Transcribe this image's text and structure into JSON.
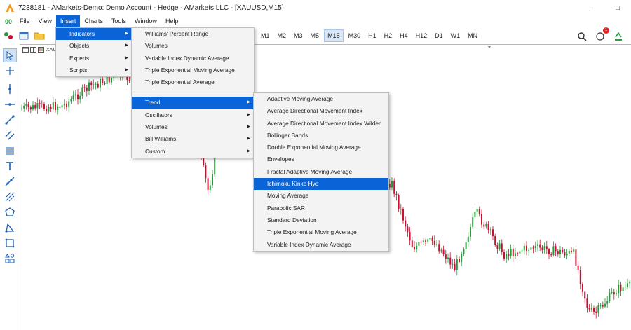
{
  "window": {
    "title": "7238181 - AMarkets-Demo: Demo Account - Hedge - AMarkets LLC - [XAUUSD,M15]",
    "controls": [
      "–",
      "□",
      "✕"
    ]
  },
  "menubar": {
    "items": [
      "File",
      "View",
      "Insert",
      "Charts",
      "Tools",
      "Window",
      "Help"
    ],
    "active": "Insert"
  },
  "toolbar": {
    "timeframes": [
      "M1",
      "M2",
      "M3",
      "M5",
      "M15",
      "M30",
      "H1",
      "H2",
      "H4",
      "H12",
      "D1",
      "W1",
      "MN"
    ],
    "selected_timeframe": "M15",
    "notification_count": "1"
  },
  "chart": {
    "tab_label": "XAUUSD"
  },
  "menus": {
    "insert": [
      "Indicators",
      "Objects",
      "Experts",
      "Scripts"
    ],
    "indicators_top": [
      "Williams' Percent Range",
      "Volumes",
      "Variable Index Dynamic Average",
      "Triple Exponential Moving Average",
      "Triple Exponential Average"
    ],
    "indicators_groups": [
      "Trend",
      "Oscillators",
      "Volumes",
      "Bill Williams",
      "Custom"
    ],
    "trend": [
      "Adaptive Moving Average",
      "Average Directional Movement Index",
      "Average Directional Movement Index Wilder",
      "Bollinger Bands",
      "Double Exponential Moving Average",
      "Envelopes",
      "Fractal Adaptive Moving Average",
      "Ichimoku Kinko Hyo",
      "Moving Average",
      "Parabolic SAR",
      "Standard Deviation",
      "Triple Exponential Moving Average",
      "Variable Index Dynamic Average"
    ],
    "highlighted": {
      "insert": "Indicators",
      "indicators": "Trend",
      "trend": "Ichimoku Kinko Hyo"
    }
  },
  "colors": {
    "bull": "#2a9a3a",
    "bear": "#c8102e",
    "menu_highlight": "#0a64d8",
    "selected_timeframe_bg": "#d8e6f5"
  }
}
